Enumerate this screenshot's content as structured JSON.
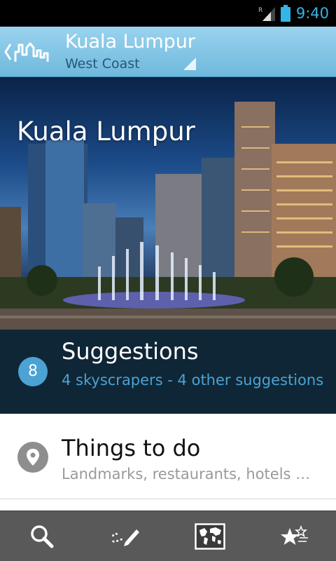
{
  "status_bar": {
    "time": "9:40",
    "roaming_label": "R",
    "accent": "#33b5e5"
  },
  "action_bar": {
    "title": "Kuala Lumpur",
    "subtitle": "West Coast",
    "back_icon": "chevron-left-icon",
    "logo_icon": "city-skyline-icon",
    "spinner_icon": "dropdown-triangle-icon"
  },
  "hero": {
    "title": "Kuala Lumpur",
    "image": "night-skyline-fountain-photo"
  },
  "suggestions": {
    "count": "8",
    "title": "Suggestions",
    "subtitle": "4 skyscrapers - 4 other suggestions"
  },
  "things_to_do": {
    "icon": "location-pin-icon",
    "title": "Things to do",
    "subtitle": "Landmarks, restaurants, hotels …"
  },
  "bottom_tabs": [
    {
      "icon": "search-icon"
    },
    {
      "icon": "pencil-trail-icon"
    },
    {
      "icon": "world-map-icon",
      "selected": true
    },
    {
      "icon": "stars-icon"
    }
  ],
  "colors": {
    "primary_blue": "#4aa3d3",
    "dark_panel": "#0f2636",
    "toolbar": "#595959"
  }
}
